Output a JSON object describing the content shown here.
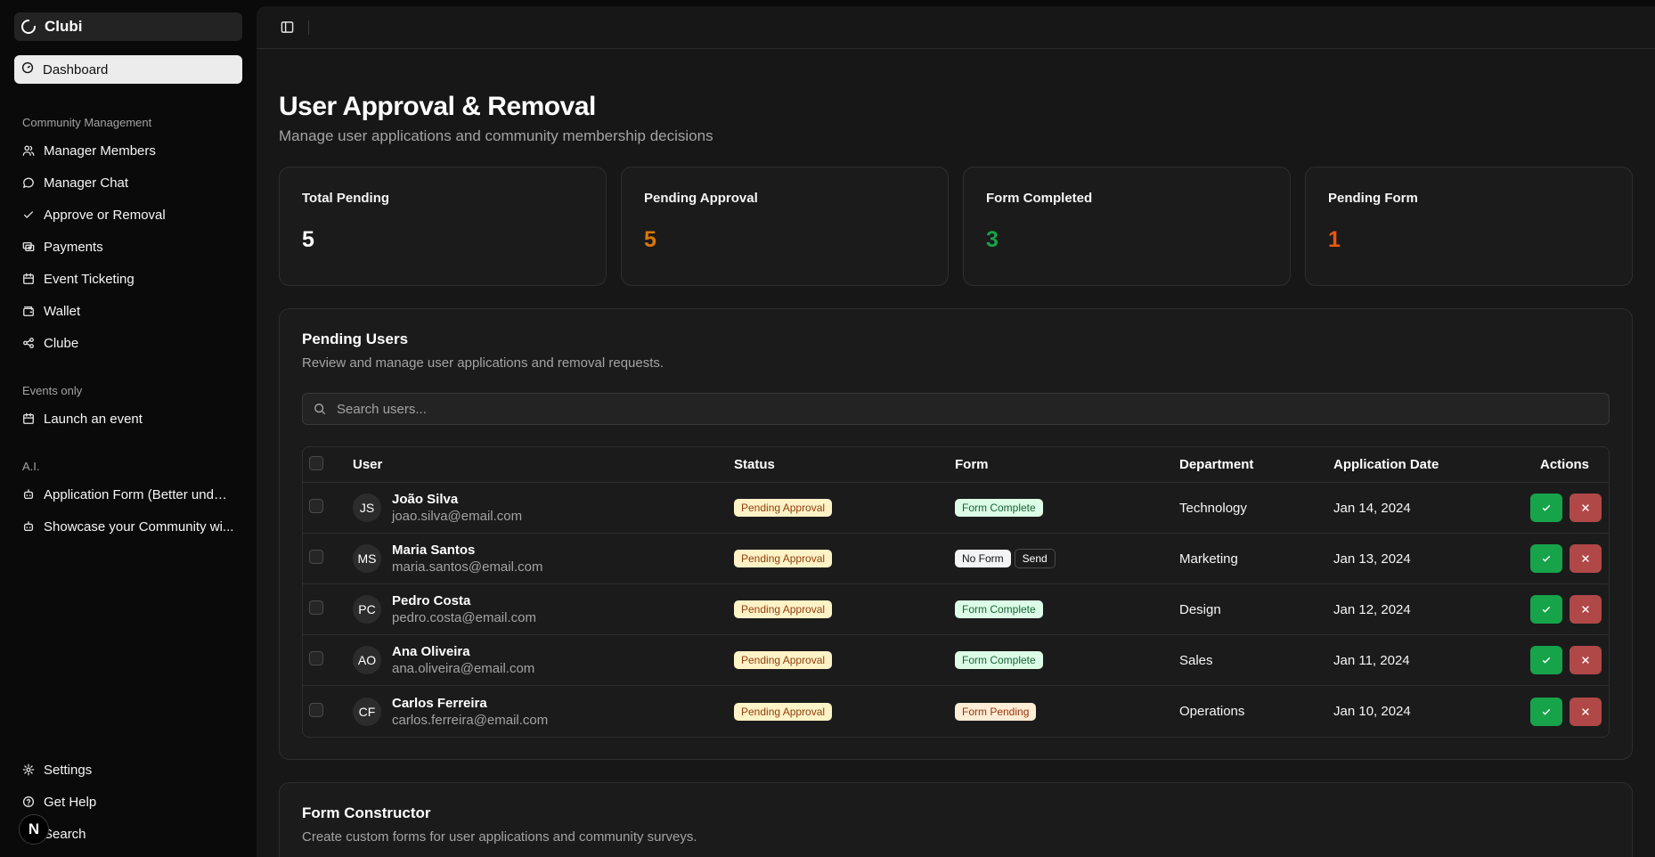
{
  "brand": {
    "name": "Clubi"
  },
  "sidebar": {
    "dashboard_label": "Dashboard",
    "sections": [
      {
        "label": "Community Management",
        "items": [
          {
            "label": "Manager Members",
            "icon": "users-icon"
          },
          {
            "label": "Manager Chat",
            "icon": "chat-icon"
          },
          {
            "label": "Approve or Removal",
            "icon": "check-icon"
          },
          {
            "label": "Payments",
            "icon": "payments-icon"
          },
          {
            "label": "Event Ticketing",
            "icon": "calendar-icon"
          },
          {
            "label": "Wallet",
            "icon": "wallet-icon"
          },
          {
            "label": "Clube",
            "icon": "share-icon"
          }
        ]
      },
      {
        "label": "Events only",
        "items": [
          {
            "label": "Launch an event",
            "icon": "calendar-icon"
          }
        ]
      },
      {
        "label": "A.I.",
        "items": [
          {
            "label": "Application Form (Better under...",
            "icon": "bot-icon"
          },
          {
            "label": "Showcase your Community wi...",
            "icon": "bot-icon"
          }
        ]
      }
    ],
    "bottom": [
      {
        "label": "Settings",
        "icon": "gear-icon"
      },
      {
        "label": "Get Help",
        "icon": "help-icon"
      },
      {
        "label": "Search",
        "icon": "search-icon"
      }
    ],
    "avatar_letter": "N"
  },
  "page": {
    "title": "User Approval & Removal",
    "subtitle": "Manage user applications and community membership decisions"
  },
  "stats": [
    {
      "label": "Total Pending",
      "value": "5",
      "color": "#ffffff"
    },
    {
      "label": "Pending Approval",
      "value": "5",
      "color": "#d97706"
    },
    {
      "label": "Form Completed",
      "value": "3",
      "color": "#16a34a"
    },
    {
      "label": "Pending Form",
      "value": "1",
      "color": "#ea580c"
    }
  ],
  "pending_users": {
    "title": "Pending Users",
    "subtitle": "Review and manage user applications and removal requests.",
    "search_placeholder": "Search users...",
    "columns": [
      "User",
      "Status",
      "Form",
      "Department",
      "Application Date",
      "Actions"
    ],
    "rows": [
      {
        "initials": "JS",
        "name": "João Silva",
        "email": "joao.silva@email.com",
        "status": "Pending Approval",
        "form": "Form Complete",
        "form_type": "complete",
        "department": "Technology",
        "date": "Jan 14, 2024"
      },
      {
        "initials": "MS",
        "name": "Maria Santos",
        "email": "maria.santos@email.com",
        "status": "Pending Approval",
        "form": "No Form",
        "form_type": "noform",
        "form_action": "Send",
        "department": "Marketing",
        "date": "Jan 13, 2024"
      },
      {
        "initials": "PC",
        "name": "Pedro Costa",
        "email": "pedro.costa@email.com",
        "status": "Pending Approval",
        "form": "Form Complete",
        "form_type": "complete",
        "department": "Design",
        "date": "Jan 12, 2024"
      },
      {
        "initials": "AO",
        "name": "Ana Oliveira",
        "email": "ana.oliveira@email.com",
        "status": "Pending Approval",
        "form": "Form Complete",
        "form_type": "complete",
        "department": "Sales",
        "date": "Jan 11, 2024"
      },
      {
        "initials": "CF",
        "name": "Carlos Ferreira",
        "email": "carlos.ferreira@email.com",
        "status": "Pending Approval",
        "form": "Form Pending",
        "form_type": "pending",
        "department": "Operations",
        "date": "Jan 10, 2024"
      }
    ]
  },
  "form_constructor": {
    "title": "Form Constructor",
    "subtitle": "Create custom forms for user applications and community surveys."
  }
}
